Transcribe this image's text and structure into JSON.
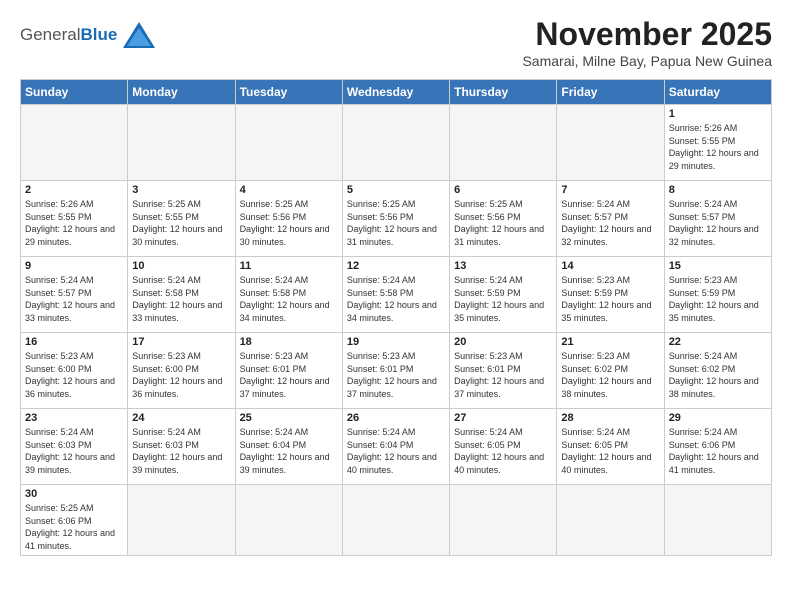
{
  "logo": {
    "line1": "General",
    "line2": "Blue"
  },
  "title": "November 2025",
  "subtitle": "Samarai, Milne Bay, Papua New Guinea",
  "days_header": [
    "Sunday",
    "Monday",
    "Tuesday",
    "Wednesday",
    "Thursday",
    "Friday",
    "Saturday"
  ],
  "weeks": [
    [
      {
        "day": "",
        "info": ""
      },
      {
        "day": "",
        "info": ""
      },
      {
        "day": "",
        "info": ""
      },
      {
        "day": "",
        "info": ""
      },
      {
        "day": "",
        "info": ""
      },
      {
        "day": "",
        "info": ""
      },
      {
        "day": "1",
        "info": "Sunrise: 5:26 AM\nSunset: 5:55 PM\nDaylight: 12 hours and 29 minutes."
      }
    ],
    [
      {
        "day": "2",
        "info": "Sunrise: 5:26 AM\nSunset: 5:55 PM\nDaylight: 12 hours and 29 minutes."
      },
      {
        "day": "3",
        "info": "Sunrise: 5:25 AM\nSunset: 5:55 PM\nDaylight: 12 hours and 30 minutes."
      },
      {
        "day": "4",
        "info": "Sunrise: 5:25 AM\nSunset: 5:56 PM\nDaylight: 12 hours and 30 minutes."
      },
      {
        "day": "5",
        "info": "Sunrise: 5:25 AM\nSunset: 5:56 PM\nDaylight: 12 hours and 31 minutes."
      },
      {
        "day": "6",
        "info": "Sunrise: 5:25 AM\nSunset: 5:56 PM\nDaylight: 12 hours and 31 minutes."
      },
      {
        "day": "7",
        "info": "Sunrise: 5:24 AM\nSunset: 5:57 PM\nDaylight: 12 hours and 32 minutes."
      },
      {
        "day": "8",
        "info": "Sunrise: 5:24 AM\nSunset: 5:57 PM\nDaylight: 12 hours and 32 minutes."
      }
    ],
    [
      {
        "day": "9",
        "info": "Sunrise: 5:24 AM\nSunset: 5:57 PM\nDaylight: 12 hours and 33 minutes."
      },
      {
        "day": "10",
        "info": "Sunrise: 5:24 AM\nSunset: 5:58 PM\nDaylight: 12 hours and 33 minutes."
      },
      {
        "day": "11",
        "info": "Sunrise: 5:24 AM\nSunset: 5:58 PM\nDaylight: 12 hours and 34 minutes."
      },
      {
        "day": "12",
        "info": "Sunrise: 5:24 AM\nSunset: 5:58 PM\nDaylight: 12 hours and 34 minutes."
      },
      {
        "day": "13",
        "info": "Sunrise: 5:24 AM\nSunset: 5:59 PM\nDaylight: 12 hours and 35 minutes."
      },
      {
        "day": "14",
        "info": "Sunrise: 5:23 AM\nSunset: 5:59 PM\nDaylight: 12 hours and 35 minutes."
      },
      {
        "day": "15",
        "info": "Sunrise: 5:23 AM\nSunset: 5:59 PM\nDaylight: 12 hours and 35 minutes."
      }
    ],
    [
      {
        "day": "16",
        "info": "Sunrise: 5:23 AM\nSunset: 6:00 PM\nDaylight: 12 hours and 36 minutes."
      },
      {
        "day": "17",
        "info": "Sunrise: 5:23 AM\nSunset: 6:00 PM\nDaylight: 12 hours and 36 minutes."
      },
      {
        "day": "18",
        "info": "Sunrise: 5:23 AM\nSunset: 6:01 PM\nDaylight: 12 hours and 37 minutes."
      },
      {
        "day": "19",
        "info": "Sunrise: 5:23 AM\nSunset: 6:01 PM\nDaylight: 12 hours and 37 minutes."
      },
      {
        "day": "20",
        "info": "Sunrise: 5:23 AM\nSunset: 6:01 PM\nDaylight: 12 hours and 37 minutes."
      },
      {
        "day": "21",
        "info": "Sunrise: 5:23 AM\nSunset: 6:02 PM\nDaylight: 12 hours and 38 minutes."
      },
      {
        "day": "22",
        "info": "Sunrise: 5:24 AM\nSunset: 6:02 PM\nDaylight: 12 hours and 38 minutes."
      }
    ],
    [
      {
        "day": "23",
        "info": "Sunrise: 5:24 AM\nSunset: 6:03 PM\nDaylight: 12 hours and 39 minutes."
      },
      {
        "day": "24",
        "info": "Sunrise: 5:24 AM\nSunset: 6:03 PM\nDaylight: 12 hours and 39 minutes."
      },
      {
        "day": "25",
        "info": "Sunrise: 5:24 AM\nSunset: 6:04 PM\nDaylight: 12 hours and 39 minutes."
      },
      {
        "day": "26",
        "info": "Sunrise: 5:24 AM\nSunset: 6:04 PM\nDaylight: 12 hours and 40 minutes."
      },
      {
        "day": "27",
        "info": "Sunrise: 5:24 AM\nSunset: 6:05 PM\nDaylight: 12 hours and 40 minutes."
      },
      {
        "day": "28",
        "info": "Sunrise: 5:24 AM\nSunset: 6:05 PM\nDaylight: 12 hours and 40 minutes."
      },
      {
        "day": "29",
        "info": "Sunrise: 5:24 AM\nSunset: 6:06 PM\nDaylight: 12 hours and 41 minutes."
      }
    ],
    [
      {
        "day": "30",
        "info": "Sunrise: 5:25 AM\nSunset: 6:06 PM\nDaylight: 12 hours and 41 minutes."
      },
      {
        "day": "",
        "info": ""
      },
      {
        "day": "",
        "info": ""
      },
      {
        "day": "",
        "info": ""
      },
      {
        "day": "",
        "info": ""
      },
      {
        "day": "",
        "info": ""
      },
      {
        "day": "",
        "info": ""
      }
    ]
  ]
}
